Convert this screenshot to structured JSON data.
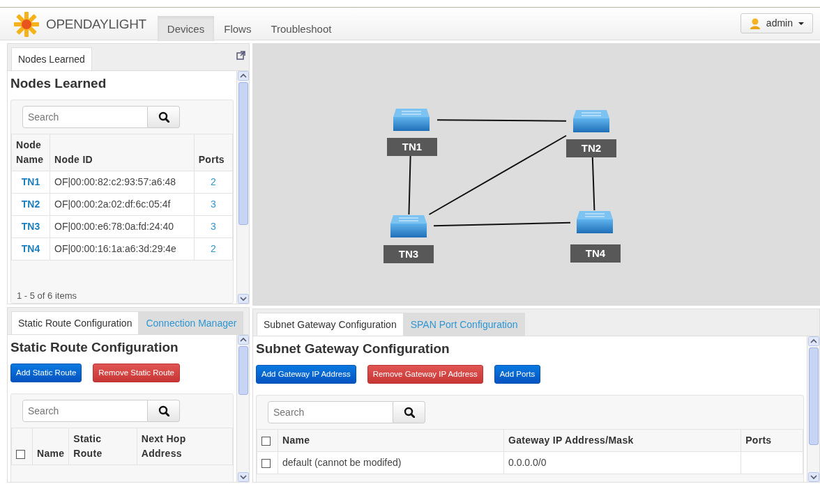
{
  "header": {
    "logo_text": "OPENDAYLIGHT",
    "user_menu": {
      "label": "admin"
    }
  },
  "nav_tabs": [
    {
      "label": "Devices",
      "selected": true
    },
    {
      "label": "Flows",
      "selected": false
    },
    {
      "label": "Troubleshoot",
      "selected": false
    }
  ],
  "nodes_panel": {
    "tabs": [
      {
        "label": "Nodes Learned",
        "selected": true
      }
    ],
    "heading": "Nodes Learned",
    "search": {
      "placeholder": "Search"
    },
    "columns": [
      "Node Name",
      "Node ID",
      "Ports"
    ],
    "rows": [
      {
        "name": "TN1",
        "node_id": "OF|00:00:82:c2:93:57:a6:48",
        "ports": "2"
      },
      {
        "name": "TN2",
        "node_id": "OF|00:00:2a:02:df:6c:05:4f",
        "ports": "3"
      },
      {
        "name": "TN3",
        "node_id": "OF|00:00:e6:78:0a:fd:24:40",
        "ports": "3"
      },
      {
        "name": "TN4",
        "node_id": "OF|00:00:16:1a:a6:3d:29:4e",
        "ports": "2"
      }
    ],
    "footer": "1 - 5 of 6 items"
  },
  "topology": {
    "nodes": [
      {
        "name": "TN1"
      },
      {
        "name": "TN2"
      },
      {
        "name": "TN3"
      },
      {
        "name": "TN4"
      }
    ]
  },
  "static_route_panel": {
    "tabs": [
      {
        "label": "Static Route Configuration",
        "selected": true
      },
      {
        "label": "Connection Manager",
        "selected": false
      }
    ],
    "heading": "Static Route Configuration",
    "buttons": [
      {
        "label": "Add Static Route",
        "kind": "primary"
      },
      {
        "label": "Remove Static Route",
        "kind": "danger"
      }
    ],
    "search": {
      "placeholder": "Search"
    },
    "select_all": {
      "checked": false
    },
    "columns": [
      "Name",
      "Static Route",
      "Next Hop Address"
    ]
  },
  "subnet_panel": {
    "tabs": [
      {
        "label": "Subnet Gateway Configuration",
        "selected": true
      },
      {
        "label": "SPAN Port Configuration",
        "selected": false
      }
    ],
    "heading": "Subnet Gateway Configuration",
    "buttons": [
      {
        "label": "Add Gateway IP Address",
        "kind": "primary"
      },
      {
        "label": "Remove Gateway IP Address",
        "kind": "danger"
      },
      {
        "label": "Add Ports",
        "kind": "primary"
      }
    ],
    "search": {
      "placeholder": "Search"
    },
    "select_all": {
      "checked": false
    },
    "columns": [
      "Name",
      "Gateway IP Address/Mask",
      "Ports"
    ],
    "rows": [
      {
        "checked": false,
        "cells": [
          "default (cannot be modifed)",
          "0.0.0.0/0"
        ]
      }
    ]
  }
}
